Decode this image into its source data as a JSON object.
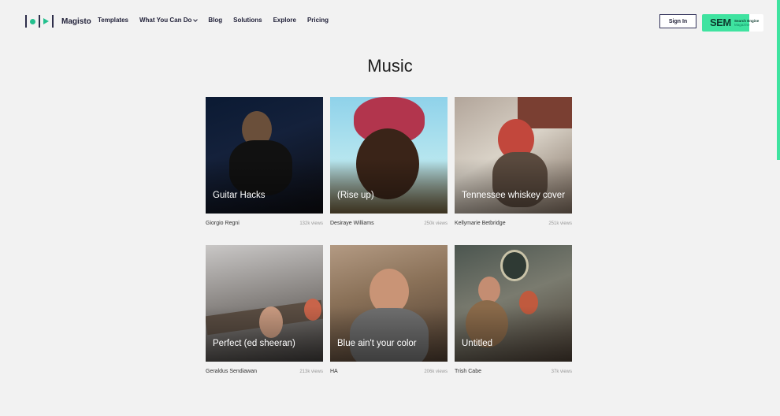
{
  "header": {
    "logo_text": "Magisto",
    "nav": [
      {
        "label": "Templates"
      },
      {
        "label": "What You Can Do",
        "has_dropdown": true
      },
      {
        "label": "Blog"
      },
      {
        "label": "Solutions"
      },
      {
        "label": "Explore"
      },
      {
        "label": "Pricing"
      }
    ],
    "signin_label": "Sign In",
    "badge": {
      "main": "SEM",
      "line1": "Search Engine",
      "line2": "Magazine"
    }
  },
  "page_title": "Music",
  "videos": [
    {
      "title": "Guitar Hacks",
      "author": "Giorgio Regni",
      "views": "132k views"
    },
    {
      "title": "(Rise up)",
      "author": "Desiraye Williams",
      "views": "250k views"
    },
    {
      "title": "Tennessee whiskey cover",
      "author": "Kellymarie Betbridge",
      "views": "251k views"
    },
    {
      "title": "Perfect (ed sheeran)",
      "author": "Geraldus Sendiawan",
      "views": "213k views"
    },
    {
      "title": "Blue ain't your color",
      "author": "HA",
      "views": "206k views"
    },
    {
      "title": "Untitled",
      "author": "Trish Cabe",
      "views": "37k views"
    }
  ],
  "colors": {
    "accent": "#24c08e",
    "background": "#f2f2f2",
    "nav_text": "#22223a"
  }
}
